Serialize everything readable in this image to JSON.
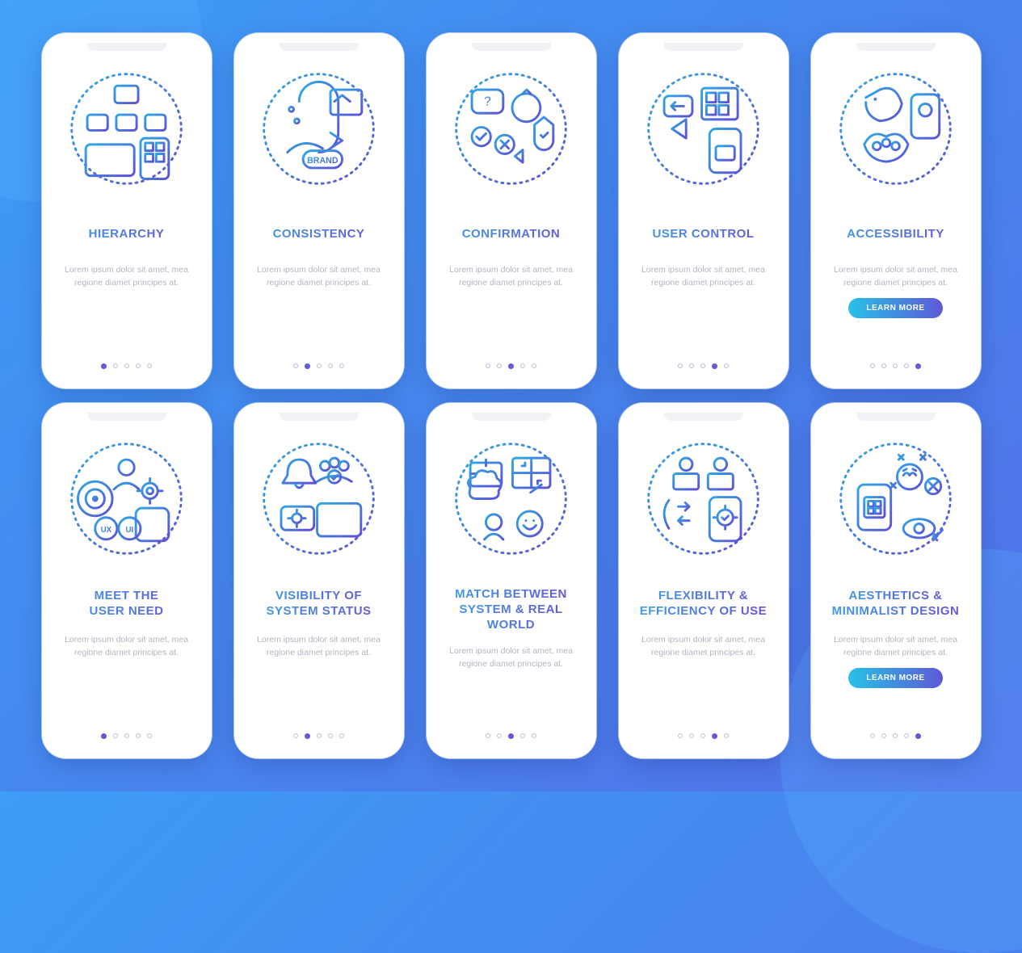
{
  "body_text": "Lorem ipsum dolor sit amet, mea regione diamet principes at.",
  "learn_more_label": "LEARN MORE",
  "dots_total": 5,
  "screens": [
    {
      "title": "HIERARCHY",
      "active_dot": 0,
      "has_button": false,
      "icon": "hierarchy"
    },
    {
      "title": "CONSISTENCY",
      "active_dot": 1,
      "has_button": false,
      "icon": "consistency"
    },
    {
      "title": "CONFIRMATION",
      "active_dot": 2,
      "has_button": false,
      "icon": "confirmation"
    },
    {
      "title": "USER CONTROL",
      "active_dot": 3,
      "has_button": false,
      "icon": "user-control"
    },
    {
      "title": "ACCESSIBILITY",
      "active_dot": 4,
      "has_button": true,
      "icon": "accessibility"
    },
    {
      "title": "MEET THE\nUSER NEED",
      "active_dot": 0,
      "has_button": false,
      "icon": "user-need"
    },
    {
      "title": "VISIBILITY OF\nSYSTEM STATUS",
      "active_dot": 1,
      "has_button": false,
      "icon": "visibility"
    },
    {
      "title": "MATCH BETWEEN\nSYSTEM & REAL WORLD",
      "active_dot": 2,
      "has_button": false,
      "icon": "match"
    },
    {
      "title": "FLEXIBILITY &\nEFFICIENCY OF USE",
      "active_dot": 3,
      "has_button": false,
      "icon": "flexibility"
    },
    {
      "title": "AESTHETICS &\nMINIMALIST DESIGN",
      "active_dot": 4,
      "has_button": true,
      "icon": "aesthetics"
    }
  ]
}
